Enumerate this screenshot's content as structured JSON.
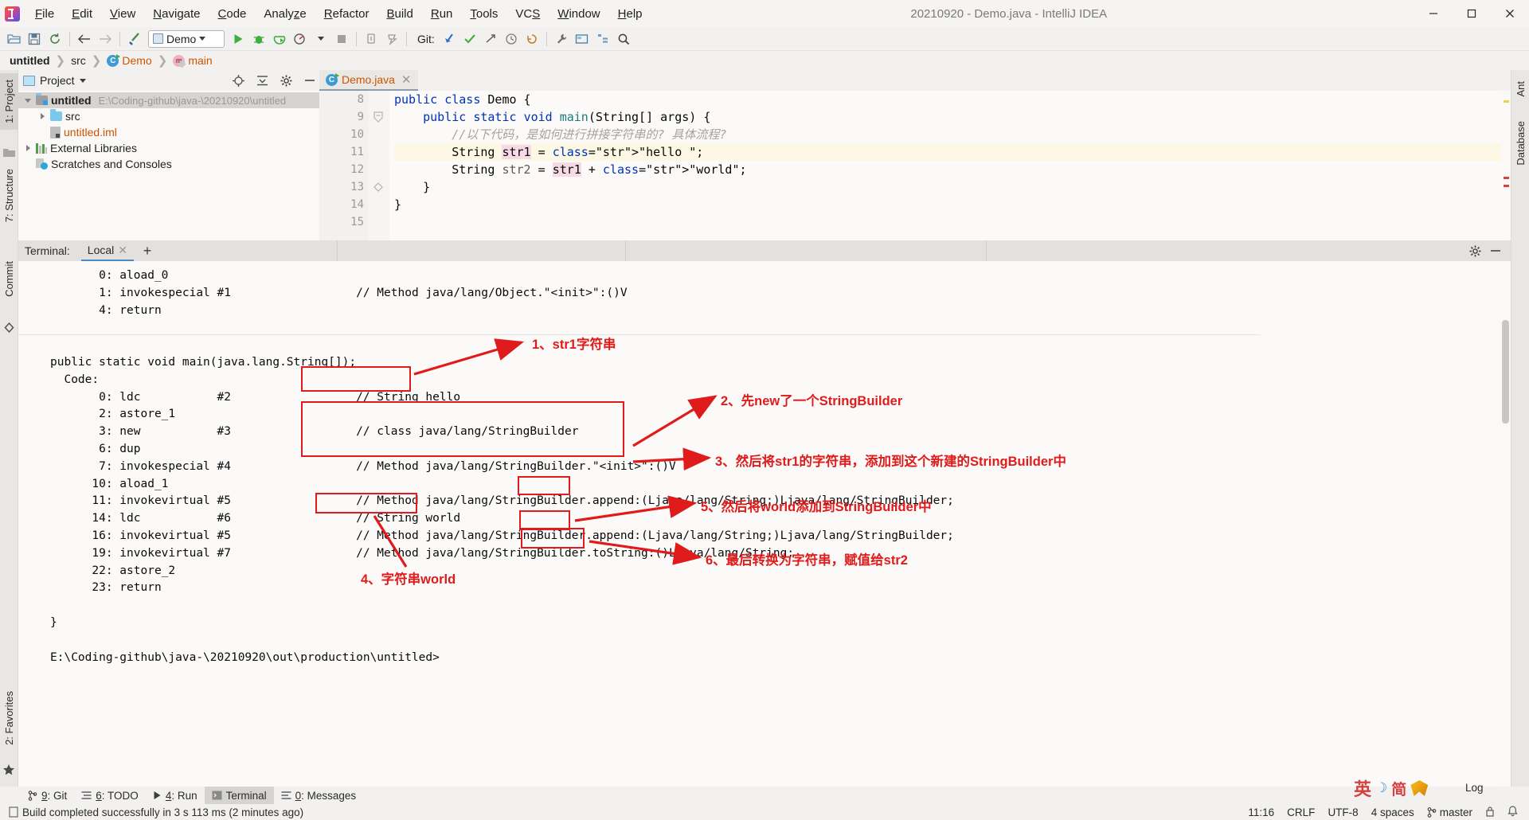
{
  "window": {
    "title": "20210920 - Demo.java - IntelliJ IDEA",
    "logo_icon": "intellij-idea-logo",
    "minimize_icon": "minimize-icon",
    "maximize_icon": "maximize-icon",
    "close_icon": "close-icon"
  },
  "menubar": {
    "items": [
      {
        "label": "File",
        "mnemonic": "F"
      },
      {
        "label": "Edit",
        "mnemonic": "E"
      },
      {
        "label": "View",
        "mnemonic": "V"
      },
      {
        "label": "Navigate",
        "mnemonic": "N"
      },
      {
        "label": "Code",
        "mnemonic": "C"
      },
      {
        "label": "Analyze",
        "mnemonic": "z"
      },
      {
        "label": "Refactor",
        "mnemonic": "R"
      },
      {
        "label": "Build",
        "mnemonic": "B"
      },
      {
        "label": "Run",
        "mnemonic": "R"
      },
      {
        "label": "Tools",
        "mnemonic": "T"
      },
      {
        "label": "VCS",
        "mnemonic": "S"
      },
      {
        "label": "Window",
        "mnemonic": "W"
      },
      {
        "label": "Help",
        "mnemonic": "H"
      }
    ]
  },
  "toolbar": {
    "open_icon": "open-folder-icon",
    "save_icon": "save-all-icon",
    "sync_icon": "reload-from-disk-icon",
    "back_icon": "navigate-back-icon",
    "forward_icon": "navigate-forward-icon",
    "build_icon": "build-hammer-icon",
    "run_config": "Demo",
    "run_config_icon": "run-configuration-icon",
    "run_icon": "run-icon",
    "debug_icon": "debug-icon",
    "coverage_icon": "run-with-coverage-icon",
    "profile_icon": "profile-icon",
    "stop_icon": "stop-icon",
    "attach_icon": "attach-debugger-icon",
    "hotswap_icon": "hotswap-icon",
    "git_label": "Git:",
    "update_icon": "vcs-update-icon",
    "commit_icon": "vcs-commit-check-icon",
    "push_icon": "vcs-push-icon",
    "history_icon": "vcs-history-icon",
    "rollback_icon": "vcs-rollback-icon",
    "wrench_icon": "settings-wrench-icon",
    "plugin_icon": "plugins-icon",
    "structure_icon": "structure-icon",
    "search_icon": "search-everywhere-icon"
  },
  "breadcrumb": {
    "items": [
      {
        "label": "untitled",
        "icon": "",
        "style": "bold"
      },
      {
        "label": "src",
        "icon": "",
        "style": "plain"
      },
      {
        "label": "Demo",
        "icon": "class-icon",
        "style": "orange"
      },
      {
        "label": "main",
        "icon": "method-icon",
        "style": "orange"
      }
    ],
    "separator": "❯"
  },
  "left_strip": {
    "tabs": [
      {
        "label": "1: Project",
        "number": "1",
        "selected": true
      },
      {
        "label": "7: Structure",
        "number": "7",
        "selected": false
      },
      {
        "label": "Commit",
        "number": "",
        "selected": false
      }
    ],
    "bottom_tab": {
      "label": "2: Favorites",
      "number": "2"
    }
  },
  "right_strip": {
    "tabs": [
      {
        "label": "Ant"
      },
      {
        "label": "Database"
      }
    ]
  },
  "project_panel": {
    "title": "Project",
    "title_icon": "project-view-icon",
    "dropdown_icon": "chevron-down-icon",
    "locate_icon": "scroll-from-source-icon",
    "collapse_icon": "collapse-all-icon",
    "settings_icon": "gear-icon",
    "hide_icon": "hide-panel-icon",
    "tree": [
      {
        "label": "untitled",
        "path": "E:\\Coding-github\\java-\\20210920\\untitled",
        "icon": "module-folder-icon",
        "indent": 0,
        "expander": "expanded",
        "selected": true,
        "bold": true
      },
      {
        "label": "src",
        "path": "",
        "icon": "source-folder-icon",
        "indent": 1,
        "expander": "collapsed",
        "selected": false,
        "bold": false
      },
      {
        "label": "untitled.iml",
        "path": "",
        "icon": "iml-file-icon",
        "indent": 1,
        "expander": "none",
        "selected": false,
        "bold": false,
        "orange": true
      },
      {
        "label": "External Libraries",
        "path": "",
        "icon": "libraries-icon",
        "indent": 0,
        "expander": "collapsed",
        "selected": false,
        "bold": false
      },
      {
        "label": "Scratches and Consoles",
        "path": "",
        "icon": "scratches-icon",
        "indent": 0,
        "expander": "none",
        "selected": false,
        "bold": false
      }
    ]
  },
  "editor": {
    "tab": {
      "label": "Demo.java",
      "icon": "java-class-icon",
      "close_icon": "close-icon"
    },
    "lines": [
      {
        "num": "8",
        "run_marker": true,
        "fold": "",
        "highlight": false,
        "indent": 0,
        "text": "public class Demo {"
      },
      {
        "num": "9",
        "run_marker": true,
        "fold": "open",
        "highlight": false,
        "indent": 1,
        "text": "public static void main(String[] args) {"
      },
      {
        "num": "10",
        "run_marker": false,
        "fold": "",
        "highlight": false,
        "indent": 2,
        "text": "//以下代码，是如何进行拼接字符串的? 具体流程?"
      },
      {
        "num": "11",
        "run_marker": false,
        "fold": "",
        "highlight": true,
        "indent": 2,
        "text": "String str1 = \"hello \";"
      },
      {
        "num": "12",
        "run_marker": false,
        "fold": "",
        "highlight": false,
        "indent": 2,
        "text": "String str2 = str1 + \"world\";"
      },
      {
        "num": "13",
        "run_marker": false,
        "fold": "close",
        "highlight": false,
        "indent": 1,
        "text": "}"
      },
      {
        "num": "14",
        "run_marker": false,
        "fold": "",
        "highlight": false,
        "indent": 0,
        "text": "}"
      },
      {
        "num": "15",
        "run_marker": false,
        "fold": "",
        "highlight": false,
        "indent": 0,
        "text": ""
      }
    ]
  },
  "terminal": {
    "label": "Terminal:",
    "tab": {
      "label": "Local",
      "close_icon": "close-icon"
    },
    "add_tab_icon": "plus-icon",
    "settings_icon": "gear-icon",
    "hide_icon": "hide-panel-icon",
    "lines": [
      "       0: aload_0",
      "       1: invokespecial #1                  // Method java/lang/Object.\"<init>\":()V",
      "       4: return",
      "",
      "",
      "public static void main(java.lang.String[]);",
      "  Code:",
      "       0: ldc           #2                  // String hello",
      "       2: astore_1",
      "       3: new           #3                  // class java/lang/StringBuilder",
      "       6: dup",
      "       7: invokespecial #4                  // Method java/lang/StringBuilder.\"<init>\":()V",
      "      10: aload_1",
      "      11: invokevirtual #5                  // Method java/lang/StringBuilder.append:(Ljava/lang/String;)Ljava/lang/StringBuilder;",
      "      14: ldc           #6                  // String world",
      "      16: invokevirtual #5                  // Method java/lang/StringBuilder.append:(Ljava/lang/String;)Ljava/lang/StringBuilder;",
      "      19: invokevirtual #7                  // Method java/lang/StringBuilder.toString:()Ljava/lang/String;",
      "      22: astore_2",
      "      23: return",
      "",
      "}",
      "",
      "E:\\Coding-github\\java-\\20210920\\out\\production\\untitled>"
    ]
  },
  "annotations": {
    "color": "#e01b1b",
    "labels": [
      {
        "id": "a1",
        "text": "1、str1字符串"
      },
      {
        "id": "a2",
        "text": "2、先new了一个StringBuilder"
      },
      {
        "id": "a3",
        "text": "3、然后将str1的字符串，添加到这个新建的StringBuilder中"
      },
      {
        "id": "a4",
        "text": "4、字符串world"
      },
      {
        "id": "a5",
        "text": "5、然后将world添加到StringBuilder中"
      },
      {
        "id": "a6",
        "text": "6、最后转换为字符串，赋值给str2"
      }
    ]
  },
  "bottom_bar": {
    "items": [
      {
        "label": "9: Git",
        "number": "9",
        "icon": "git-branch-icon",
        "selected": false
      },
      {
        "label": "6: TODO",
        "number": "6",
        "icon": "todo-list-icon",
        "selected": false
      },
      {
        "label": "4: Run",
        "number": "4",
        "icon": "run-icon",
        "selected": false
      },
      {
        "label": "Terminal",
        "number": "",
        "icon": "terminal-icon",
        "selected": true
      },
      {
        "label": "0: Messages",
        "number": "0",
        "icon": "messages-icon",
        "selected": false
      }
    ]
  },
  "status_bar": {
    "build_icon": "build-status-icon",
    "build_message": "Build completed successfully in 3 s 113 ms (2 minutes ago)",
    "time": "11:16",
    "line_separator": "CRLF",
    "encoding": "UTF-8",
    "indent": "4 spaces",
    "branch": "master",
    "branch_icon": "git-branch-icon",
    "lock_icon": "read-only-lock-icon",
    "notifications_icon": "notifications-icon"
  },
  "ime_widget": {
    "lang": "英",
    "moon": "☽",
    "mode": "简",
    "ribbon_icon": "ime-ribbon-icon",
    "log_label": "Log"
  }
}
